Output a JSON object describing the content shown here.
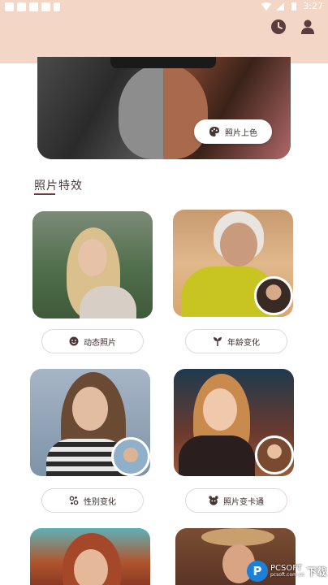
{
  "status_bar": {
    "time": "3:27"
  },
  "banner": {
    "colorize_label": "照片上色"
  },
  "section": {
    "title": "照片特效"
  },
  "features": [
    {
      "label": "动态照片",
      "icon": "face-icon"
    },
    {
      "label": "年龄变化",
      "icon": "sprout-icon"
    },
    {
      "label": "性别变化",
      "icon": "gender-icon"
    },
    {
      "label": "照片变卡通",
      "icon": "cartoon-icon"
    }
  ],
  "watermark": {
    "brand": "PCSOFT",
    "site": "pcsoft.com.cn",
    "tag": "下载"
  },
  "colors": {
    "header_bg": "#f3d6c6",
    "accent": "#6b3b3b"
  }
}
